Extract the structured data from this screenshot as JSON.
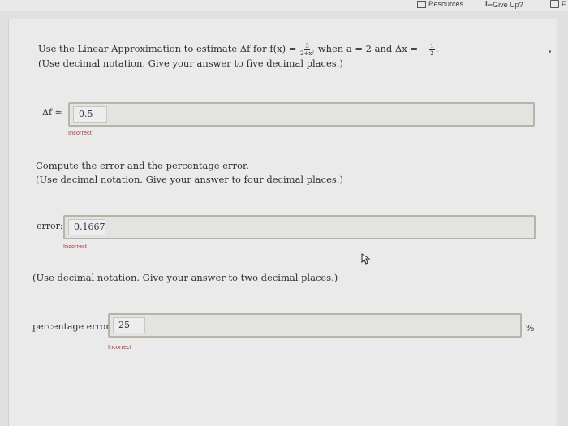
{
  "topbar": {
    "resources": "Resources",
    "give_up": "Give Up?",
    "extra": "F"
  },
  "q1": {
    "line1_a": "Use the Linear Approximation to estimate Δf for f(x) =",
    "frac_num": "3",
    "frac_den": "2+x²",
    "line1_b": "when a = 2 and Δx = −",
    "dx_num": "1",
    "dx_den": "2",
    "line1_c": ".",
    "line2": "(Use decimal notation. Give your answer to five decimal places.)",
    "label": "Δf ≈",
    "value": "0.5",
    "status": "Incorrect"
  },
  "q2": {
    "line1": "Compute the error and the percentage error.",
    "line2": "(Use decimal notation. Give your answer to four decimal places.)",
    "label": "error:",
    "value": "0.1667",
    "status": "Incorrect"
  },
  "q3": {
    "line1": "(Use decimal notation. Give your answer to two decimal places.)",
    "label": "percentage error:",
    "value": "25",
    "unit": "%",
    "status": "Incorrect"
  }
}
